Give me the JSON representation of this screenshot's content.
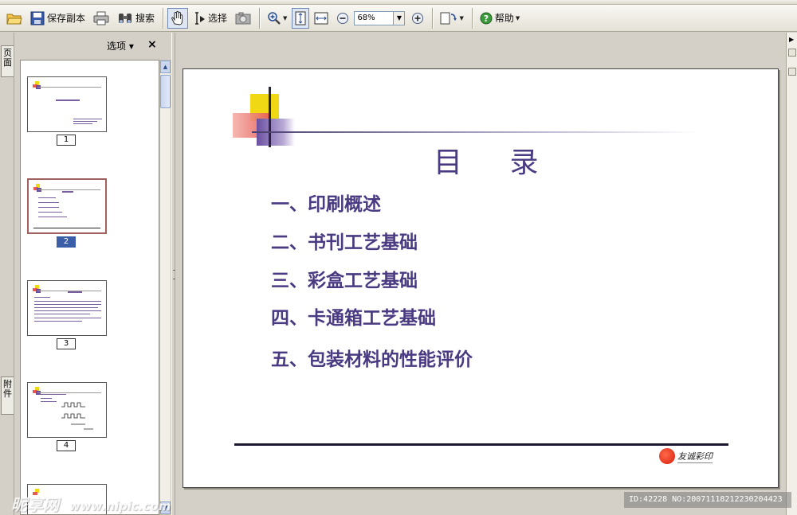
{
  "toolbar": {
    "save_copy_label": "保存副本",
    "search_label": "搜索",
    "select_label": "选择",
    "zoom_value": "68%",
    "help_label": "帮助"
  },
  "left_tabs": {
    "pages_tab": "页面",
    "attachments_tab": "附件"
  },
  "pages_panel": {
    "options_label": "选项 ▾",
    "close_label": "×",
    "thumbnails": [
      {
        "label": "1",
        "selected": false
      },
      {
        "label": "2",
        "selected": true
      },
      {
        "label": "3",
        "selected": false
      },
      {
        "label": "4",
        "selected": false
      },
      {
        "label": "",
        "selected": false
      }
    ]
  },
  "slide": {
    "title": "目 录",
    "items": [
      "一、印刷概述",
      "二、书刊工艺基础",
      "三、彩盒工艺基础",
      "四、卡通箱工艺基础",
      "五、包装材料的性能评价"
    ],
    "logo_text": "友诚彩印"
  },
  "watermark": {
    "site_name": "昵享网",
    "site_url": "www.nipic.com",
    "id_text": "ID:42228 NO:20071118212230204423"
  },
  "colors": {
    "slide_text": "#4a3a82",
    "selection": "#3a5fa8"
  }
}
